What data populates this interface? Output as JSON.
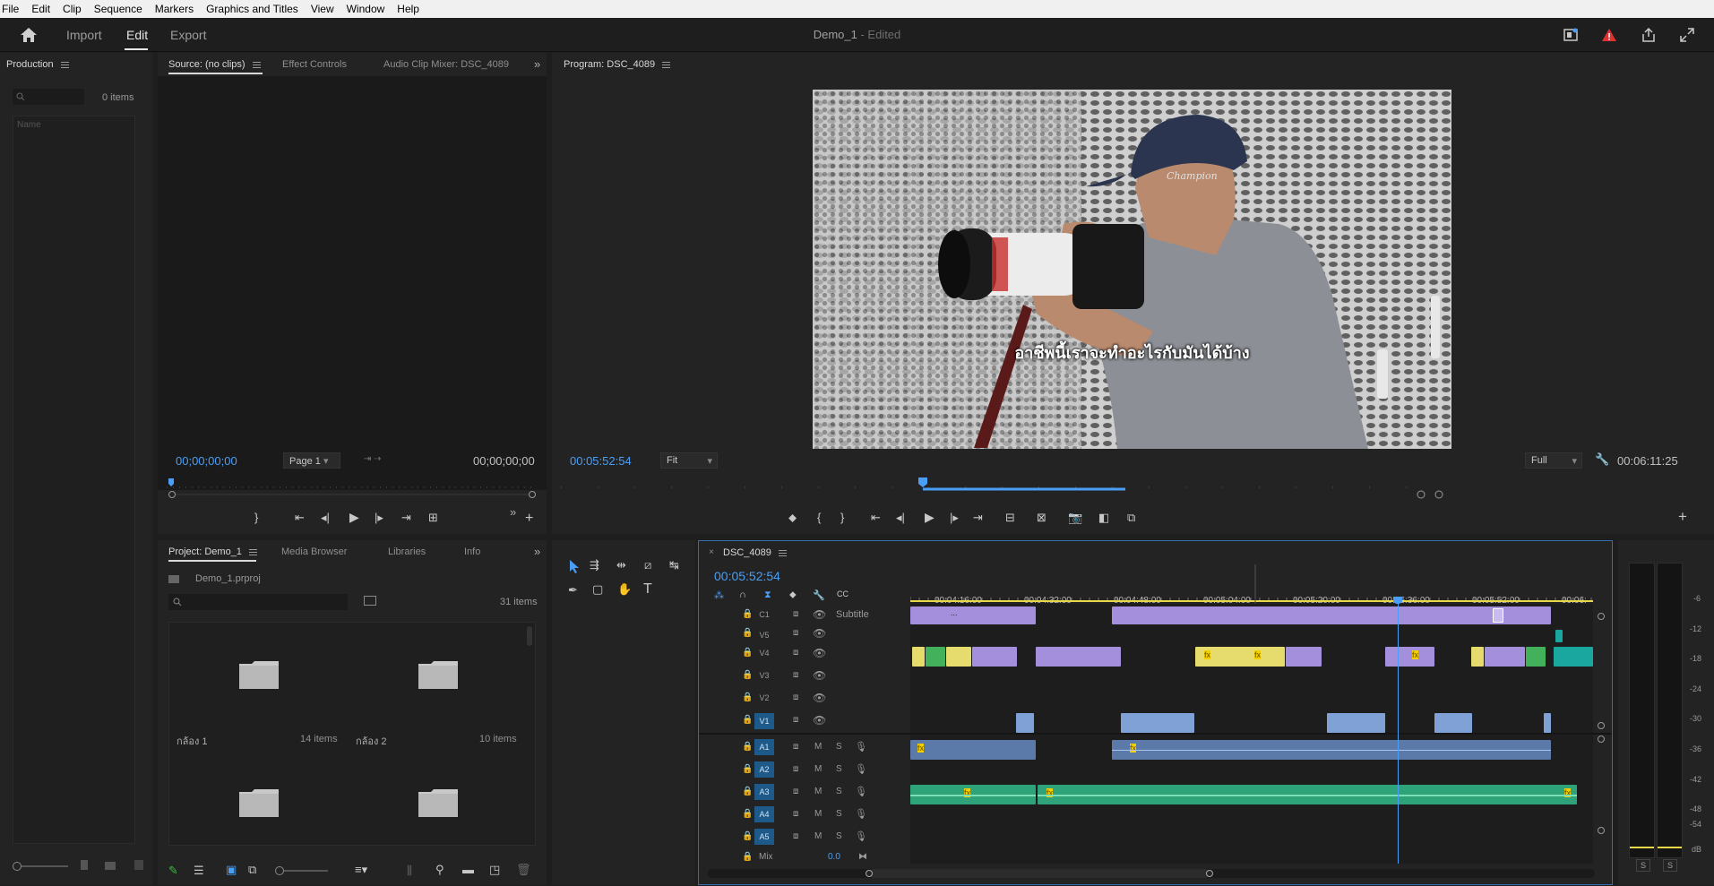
{
  "menu": [
    "File",
    "Edit",
    "Clip",
    "Sequence",
    "Markers",
    "Graphics and Titles",
    "View",
    "Window",
    "Help"
  ],
  "header": {
    "tabs": [
      "Import",
      "Edit",
      "Export"
    ],
    "active_tab": "Edit",
    "project_title": "Demo_1",
    "edited": "- Edited"
  },
  "production": {
    "title": "Production",
    "items": "0 items",
    "name_col": "Name"
  },
  "source": {
    "tabs": [
      "Source: (no clips)",
      "Effect Controls",
      "Audio Clip Mixer: DSC_4089"
    ],
    "timecode_in": "00;00;00;00",
    "page": "Page 1",
    "timecode_out": "00;00;00;00"
  },
  "program": {
    "title": "Program: DSC_4089",
    "timecode": "00:05:52:54",
    "fit": "Fit",
    "quality": "Full",
    "duration": "00:06:11:25",
    "subtitle": "อาชีพนี้เราจะทำอะไรกับมันได้บ้าง",
    "cap_text": "Champion"
  },
  "project": {
    "tabs": [
      "Project: Demo_1",
      "Media Browser",
      "Libraries",
      "Info"
    ],
    "file": "Demo_1.prproj",
    "count": "31 items",
    "bins": [
      {
        "name": "กล้อง 1",
        "items": "14 items"
      },
      {
        "name": "กล้อง 2",
        "items": "10 items"
      }
    ]
  },
  "timeline": {
    "sequence": "DSC_4089",
    "timecode": "00:05:52:54",
    "ruler": [
      "00:04:16:00",
      "00:04:32:00",
      "00:04:48:00",
      "00:05:04:00",
      "00:05:20:00",
      "00:05:36:00",
      "00:05:52:00",
      "00:06:"
    ],
    "subtitle_track": "Subtitle",
    "subtitle_dots": "...",
    "video_tracks": [
      "C1",
      "V5",
      "V4",
      "V3",
      "V2",
      "V1"
    ],
    "audio_tracks": [
      "A1",
      "A2",
      "A3",
      "A4",
      "A5"
    ],
    "mix_label": "Mix",
    "mix_value": "0.0",
    "btn_m": "M",
    "btn_s": "S",
    "fx": "fx"
  },
  "meter": {
    "scale": [
      "-6",
      "-12",
      "-18",
      "-24",
      "-30",
      "-36",
      "-42",
      "-48",
      "-54",
      "dB"
    ],
    "solo_l": "S",
    "solo_r": "S"
  },
  "colors": {
    "accent": "#4a9ef5",
    "clip_purple": "#a48fdc",
    "clip_yellow": "#e6dc6e",
    "clip_green": "#43b05c",
    "clip_blue": "#7fa1d6",
    "clip_teal": "#1aa7a0",
    "audio_green": "#2ea37a",
    "warn_red": "#e03131"
  }
}
